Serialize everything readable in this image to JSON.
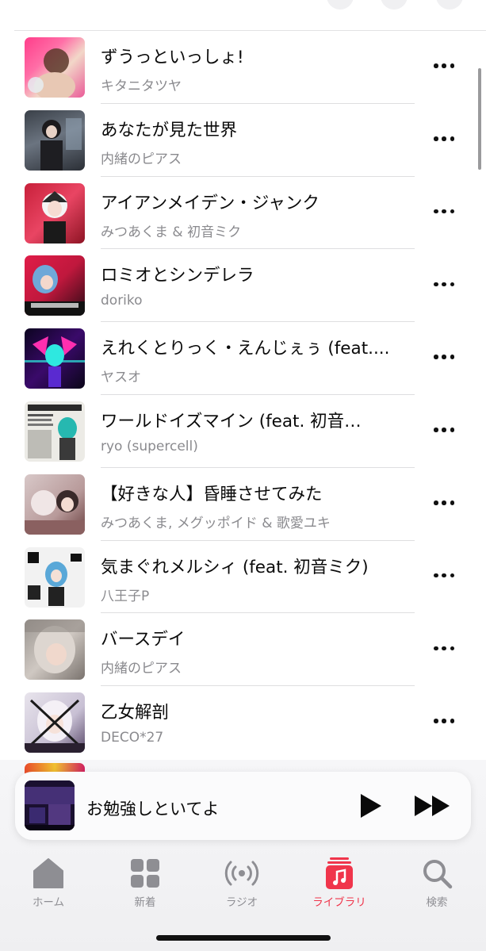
{
  "songs": [
    {
      "title": "ずうっといっしょ!",
      "artist": "キタニタツヤ"
    },
    {
      "title": "あなたが見た世界",
      "artist": "内緒のピアス"
    },
    {
      "title": "アイアンメイデン・ジャンク",
      "artist": "みつあくま & 初音ミク"
    },
    {
      "title": "ロミオとシンデレラ",
      "artist": "doriko"
    },
    {
      "title": "えれくとりっく・えんじぇぅ (feat....",
      "artist": "ヤスオ"
    },
    {
      "title": "ワールドイズマイン (feat. 初音…",
      "artist": "ryo (supercell)"
    },
    {
      "title": "【好きな人】昏睡させてみた",
      "artist": "みつあくま, メグッポイド & 歌愛ユキ"
    },
    {
      "title": "気まぐれメルシィ (feat. 初音ミク)",
      "artist": "八王子P"
    },
    {
      "title": "バースデイ",
      "artist": "内緒のピアス"
    },
    {
      "title": "乙女解剖",
      "artist": "DECO*27"
    }
  ],
  "now_playing": {
    "title": "お勉強しといてよ"
  },
  "tabs": [
    {
      "label": "ホーム",
      "icon": "home-icon"
    },
    {
      "label": "新着",
      "icon": "grid-icon"
    },
    {
      "label": "ラジオ",
      "icon": "radio-icon"
    },
    {
      "label": "ライブラリ",
      "icon": "library-icon"
    },
    {
      "label": "検索",
      "icon": "search-icon"
    }
  ],
  "active_tab": "ライブラリ",
  "colors": {
    "accent": "#f0354b",
    "inactive": "#8e8e93"
  }
}
